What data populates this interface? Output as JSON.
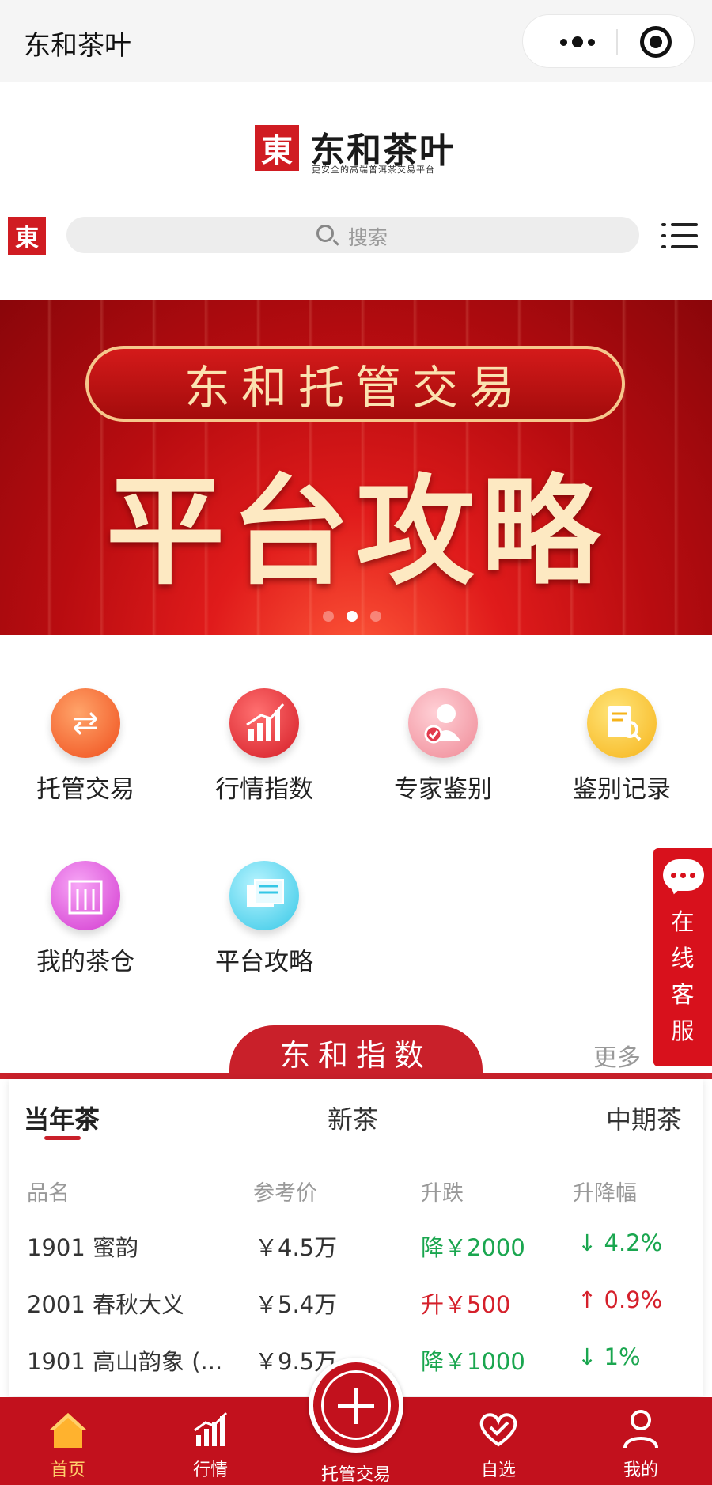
{
  "topbar": {
    "title": "东和茶叶"
  },
  "logo": {
    "mark": "東",
    "name": "东和茶叶",
    "slogan": "更安全的高端普洱茶交易平台"
  },
  "search": {
    "placeholder": "搜索"
  },
  "banner": {
    "pill_text": "东和托管交易",
    "headline": "平台攻略",
    "slides_total": 3,
    "active_slide": 2
  },
  "functions": [
    {
      "label": "托管交易",
      "icon": "exchange-icon"
    },
    {
      "label": "行情指数",
      "icon": "bar-chart-icon"
    },
    {
      "label": "专家鉴别",
      "icon": "expert-check-icon"
    },
    {
      "label": "鉴别记录",
      "icon": "document-search-icon"
    },
    {
      "label": "我的茶仓",
      "icon": "warehouse-icon"
    },
    {
      "label": "平台攻略",
      "icon": "guide-docs-icon"
    }
  ],
  "service": {
    "label_chars": [
      "在",
      "线",
      "客",
      "服"
    ]
  },
  "index": {
    "title": "东和指数",
    "more": "更多",
    "segments": [
      "当年茶",
      "新茶",
      "中期茶"
    ],
    "active_segment": 0,
    "columns": [
      "品名",
      "参考价",
      "升跌",
      "升降幅"
    ],
    "rows": [
      {
        "name": "1901 蜜韵",
        "price": "￥4.5万",
        "change": "降￥2000",
        "pct": "↓ 4.2%",
        "dir": "down"
      },
      {
        "name": "2001 春秋大义",
        "price": "￥5.4万",
        "change": "升￥500",
        "pct": "↑ 0.9%",
        "dir": "up"
      },
      {
        "name": "1901 高山韵象 (...",
        "price": "￥9.5万",
        "change": "降￥1000",
        "pct": "↓ 1%",
        "dir": "down"
      }
    ]
  },
  "tabbar": {
    "items": [
      {
        "label": "首页",
        "active": true
      },
      {
        "label": "行情",
        "active": false
      },
      {
        "label": "托管交易",
        "active": false
      },
      {
        "label": "自选",
        "active": false
      },
      {
        "label": "我的",
        "active": false
      }
    ]
  },
  "colors": {
    "brand_red": "#c9202a",
    "up": "#d5202b",
    "down": "#1aa64f",
    "active_tab": "#ffcf6a"
  }
}
